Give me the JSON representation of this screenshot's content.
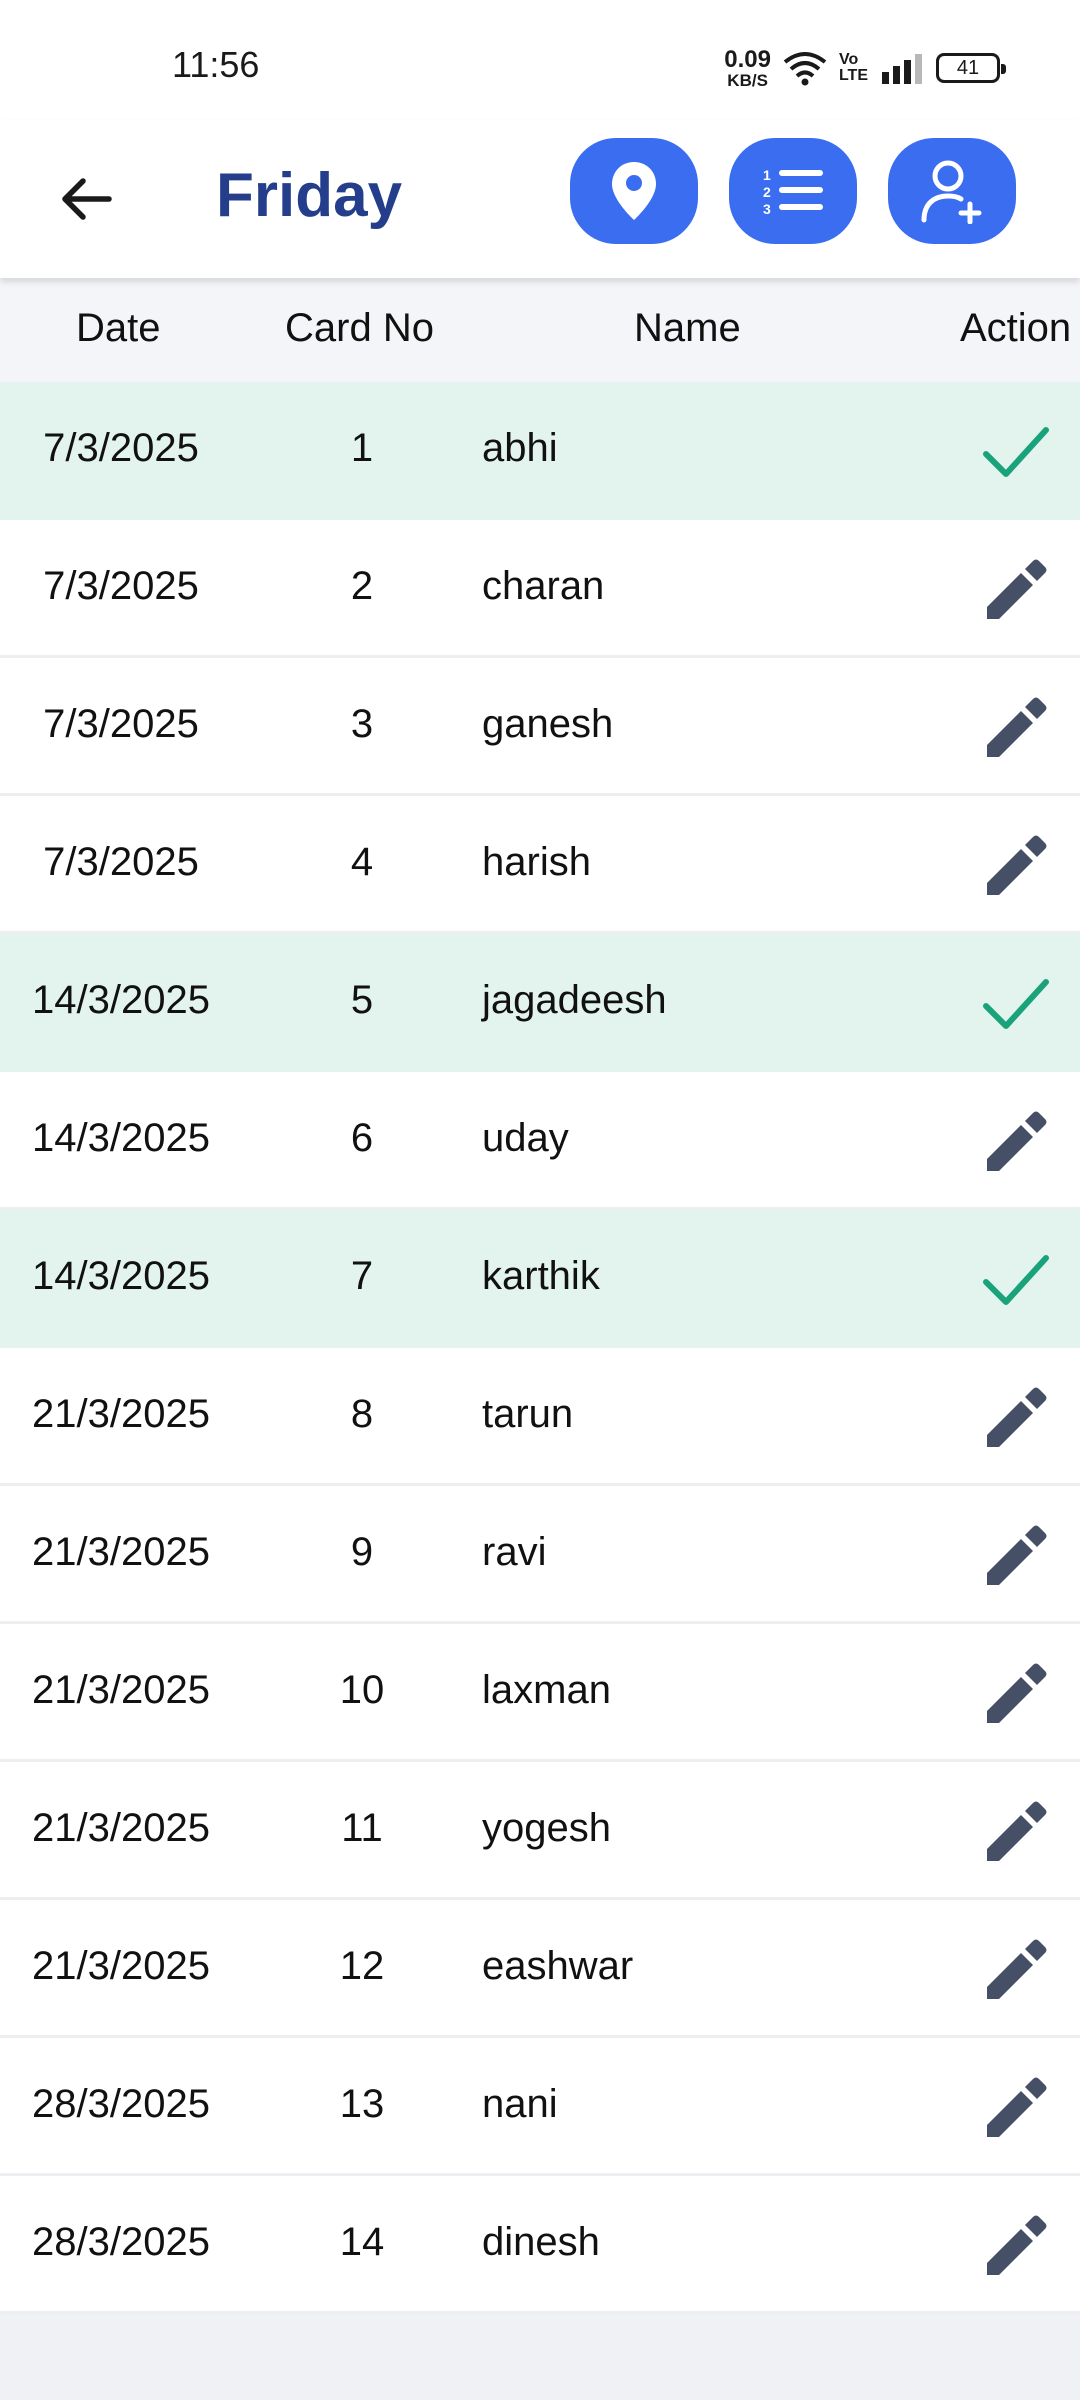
{
  "status_bar": {
    "time": "11:56",
    "net_speed_value": "0.09",
    "net_speed_unit": "KB/S",
    "volte_top": "Vo",
    "volte_bottom": "LTE",
    "battery": "41"
  },
  "app_bar": {
    "title": "Friday",
    "back_icon": "arrow-left-icon",
    "actions": [
      {
        "icon": "location-pin-icon"
      },
      {
        "icon": "numbered-list-icon"
      },
      {
        "icon": "add-user-icon"
      }
    ],
    "accent_color": "#3a6df0",
    "title_color": "#243e8c"
  },
  "table": {
    "headers": {
      "date": "Date",
      "card_no": "Card No",
      "name": "Name",
      "action": "Action"
    },
    "rows": [
      {
        "date": "7/3/2025",
        "card_no": "1",
        "name": "abhi",
        "status": "done"
      },
      {
        "date": "7/3/2025",
        "card_no": "2",
        "name": "charan",
        "status": "edit"
      },
      {
        "date": "7/3/2025",
        "card_no": "3",
        "name": "ganesh",
        "status": "edit"
      },
      {
        "date": "7/3/2025",
        "card_no": "4",
        "name": "harish",
        "status": "edit"
      },
      {
        "date": "14/3/2025",
        "card_no": "5",
        "name": "jagadeesh",
        "status": "done"
      },
      {
        "date": "14/3/2025",
        "card_no": "6",
        "name": "uday",
        "status": "edit"
      },
      {
        "date": "14/3/2025",
        "card_no": "7",
        "name": "karthik",
        "status": "done"
      },
      {
        "date": "21/3/2025",
        "card_no": "8",
        "name": "tarun",
        "status": "edit"
      },
      {
        "date": "21/3/2025",
        "card_no": "9",
        "name": "ravi",
        "status": "edit"
      },
      {
        "date": "21/3/2025",
        "card_no": "10",
        "name": "laxman",
        "status": "edit"
      },
      {
        "date": "21/3/2025",
        "card_no": "11",
        "name": "yogesh",
        "status": "edit"
      },
      {
        "date": "21/3/2025",
        "card_no": "12",
        "name": "eashwar",
        "status": "edit"
      },
      {
        "date": "28/3/2025",
        "card_no": "13",
        "name": "nani",
        "status": "edit"
      },
      {
        "date": "28/3/2025",
        "card_no": "14",
        "name": "dinesh",
        "status": "edit"
      }
    ],
    "done_row_color": "#e3f4ef",
    "check_color": "#1aa37a",
    "pencil_color": "#454f66"
  }
}
